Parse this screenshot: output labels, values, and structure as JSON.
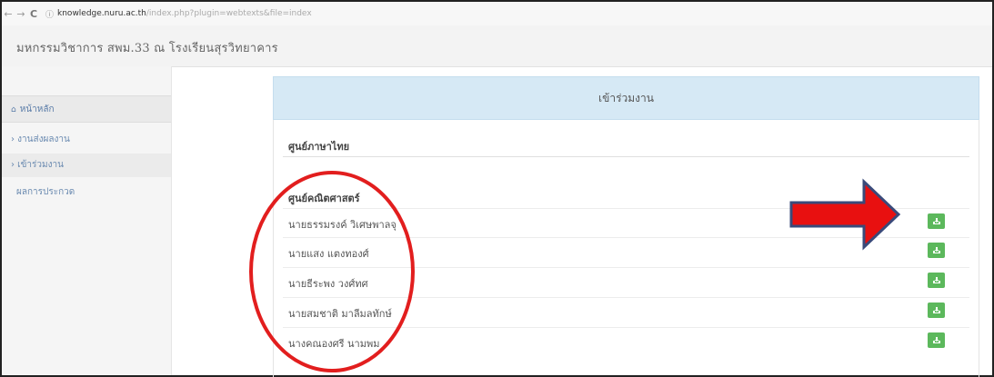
{
  "browser": {
    "back": "←",
    "forward": "→",
    "reload": "C",
    "url_host": "knowledge.nuru.ac.th",
    "url_rest": "/index.php?plugin=webtexts&file=index"
  },
  "site": {
    "title": "มหกรรมวิชาการ สพม.33 ณ โรงเรียนสุรวิทยาคาร"
  },
  "sidebar": {
    "items": [
      {
        "icon": "home-icon",
        "label": "หน้าหลัก"
      },
      {
        "label": "› งานส่งผลงาน"
      },
      {
        "label": "› เข้าร่วมงาน"
      },
      {
        "label": "ผลการประกวด"
      }
    ]
  },
  "main": {
    "panel_title": "เข้าร่วมงาน",
    "group1_title": "ศูนย์ภาษาไทย",
    "group2_title": "ศูนย์คณิตศาสตร์",
    "rows": [
      {
        "label": "นายธรรมรงค์ วิเศษพาลจุ"
      },
      {
        "label": "นายแสง แตงทองศ์"
      },
      {
        "label": "นายธีระพง วงศ์ทศ"
      },
      {
        "label": "นายสมชาติ มาลีมลทักษ์"
      },
      {
        "label": "นางคณองศรี นามพม"
      }
    ],
    "button_icon": "download-icon"
  },
  "colors": {
    "accent_green": "#5cb85c",
    "panel_head": "#d6e9f5",
    "annotation_red": "#e21e1e",
    "arrow_outline": "#3a4a7a"
  }
}
